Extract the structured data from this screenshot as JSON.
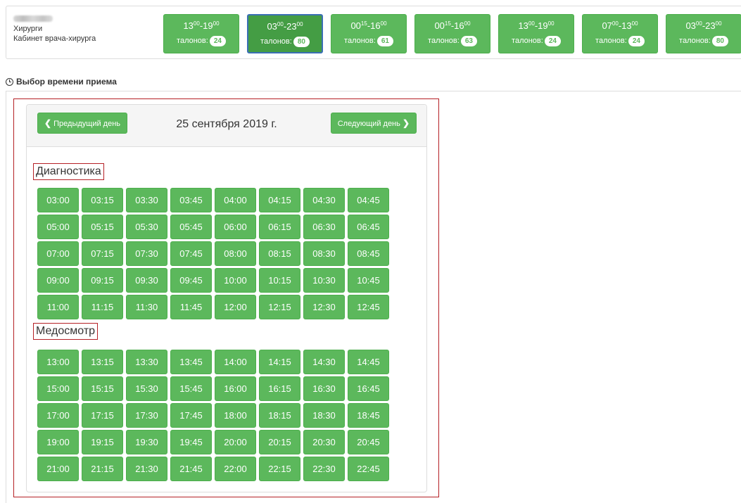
{
  "doctor": {
    "specialty": "Хирурги",
    "cabinet": "Кабинет врача-хирурга"
  },
  "schedule": [
    {
      "start_h": "13",
      "start_m": "00",
      "end_h": "19",
      "end_m": "00",
      "tickets_label": "талонов:",
      "count": "24",
      "selected": false
    },
    {
      "start_h": "03",
      "start_m": "00",
      "end_h": "23",
      "end_m": "00",
      "tickets_label": "талонов:",
      "count": "80",
      "selected": true
    },
    {
      "start_h": "00",
      "start_m": "15",
      "end_h": "16",
      "end_m": "00",
      "tickets_label": "талонов:",
      "count": "61",
      "selected": false
    },
    {
      "start_h": "00",
      "start_m": "15",
      "end_h": "16",
      "end_m": "00",
      "tickets_label": "талонов:",
      "count": "63",
      "selected": false
    },
    {
      "start_h": "13",
      "start_m": "00",
      "end_h": "19",
      "end_m": "00",
      "tickets_label": "талонов:",
      "count": "24",
      "selected": false
    },
    {
      "start_h": "07",
      "start_m": "00",
      "end_h": "13",
      "end_m": "00",
      "tickets_label": "талонов:",
      "count": "24",
      "selected": false
    },
    {
      "start_h": "03",
      "start_m": "00",
      "end_h": "23",
      "end_m": "00",
      "tickets_label": "талонов:",
      "count": "80",
      "selected": false
    }
  ],
  "section_title": "Выбор времени приема",
  "calendar": {
    "prev_label": "Предыдущий день",
    "next_label": "Следующий день",
    "date": "25 сентября 2019 г."
  },
  "groups": [
    {
      "label": "Диагностика",
      "times": [
        "03:00",
        "03:15",
        "03:30",
        "03:45",
        "04:00",
        "04:15",
        "04:30",
        "04:45",
        "05:00",
        "05:15",
        "05:30",
        "05:45",
        "06:00",
        "06:15",
        "06:30",
        "06:45",
        "07:00",
        "07:15",
        "07:30",
        "07:45",
        "08:00",
        "08:15",
        "08:30",
        "08:45",
        "09:00",
        "09:15",
        "09:30",
        "09:45",
        "10:00",
        "10:15",
        "10:30",
        "10:45",
        "11:00",
        "11:15",
        "11:30",
        "11:45",
        "12:00",
        "12:15",
        "12:30",
        "12:45"
      ]
    },
    {
      "label": "Медосмотр",
      "times": [
        "13:00",
        "13:15",
        "13:30",
        "13:45",
        "14:00",
        "14:15",
        "14:30",
        "14:45",
        "15:00",
        "15:15",
        "15:30",
        "15:45",
        "16:00",
        "16:15",
        "16:30",
        "16:45",
        "17:00",
        "17:15",
        "17:30",
        "17:45",
        "18:00",
        "18:15",
        "18:30",
        "18:45",
        "19:00",
        "19:15",
        "19:30",
        "19:45",
        "20:00",
        "20:15",
        "20:30",
        "20:45",
        "21:00",
        "21:15",
        "21:30",
        "21:45",
        "22:00",
        "22:15",
        "22:30",
        "22:45"
      ]
    }
  ],
  "colors": {
    "accent_green": "#5cb85c",
    "selected_green": "#449d44",
    "selected_border": "#3a6fb4",
    "highlight_red": "#b52025"
  }
}
